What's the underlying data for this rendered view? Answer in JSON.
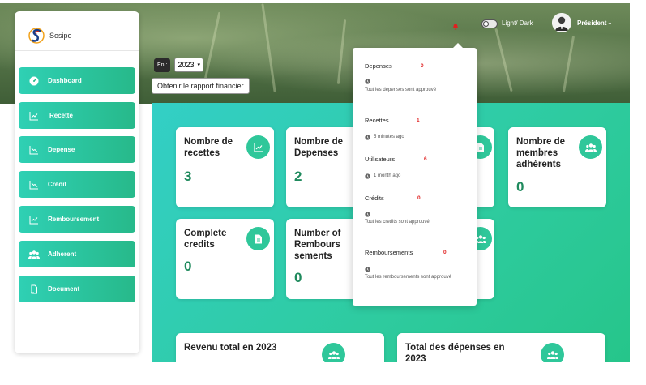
{
  "brand": {
    "name": "Sosipo"
  },
  "sidebar": {
    "items": [
      {
        "label": "Dashboard",
        "icon": "gauge-icon"
      },
      {
        "label": "Recette",
        "icon": "chart-line-icon"
      },
      {
        "label": "Depense",
        "icon": "chart-down-icon"
      },
      {
        "label": "Crédit",
        "icon": "chart-down-icon"
      },
      {
        "label": "Remboursement",
        "icon": "chart-line-icon"
      },
      {
        "label": "Adherent",
        "icon": "users-icon"
      },
      {
        "label": "Document",
        "icon": "document-icon"
      }
    ]
  },
  "filters": {
    "lang_label": "En :",
    "year": "2023",
    "report_button": "Obtenir le rapport financier"
  },
  "topbar": {
    "mode_label": "Light/ Dark",
    "user_name": "Président"
  },
  "cards": {
    "nb_recettes": {
      "title_1": "Nombre de",
      "title_2": "recettes",
      "value": "3"
    },
    "nb_depenses": {
      "title_1": "Nombre de",
      "title_2": "Depenses",
      "value": "2"
    },
    "nb_membres": {
      "title_1": "Nombre de",
      "title_2": "membres",
      "title_3": "adhérents",
      "value": "0"
    },
    "complete_credits": {
      "title_1": "Complete",
      "title_2": "credits",
      "value": "0"
    },
    "nb_remboursements": {
      "title_1": "Number of",
      "title_2": "Rembours",
      "title_3": "sements",
      "value": "0"
    },
    "revenu_total": {
      "title_1": "Revenu total en 2023"
    },
    "total_depenses": {
      "title_1": "Total des dépenses en",
      "title_2": "2023"
    }
  },
  "notifications": [
    {
      "title": "Depenses",
      "count": "0",
      "subtitle": "Tout les depenses sont approuvé"
    },
    {
      "title": "Recettes",
      "count": "1",
      "subtitle": "5 minutes ago"
    },
    {
      "title": "Utilisateurs",
      "count": "6",
      "subtitle": "1 month ago"
    },
    {
      "title": "Crédits",
      "count": "0",
      "subtitle": "Tout les credits sont approuvé"
    },
    {
      "title": "Remboursements",
      "count": "0",
      "subtitle": "Tout les remboursements sont approuvé"
    }
  ],
  "colors": {
    "accent": "#2fc79a",
    "value": "#1f8a5d",
    "alert": "#e02020"
  }
}
